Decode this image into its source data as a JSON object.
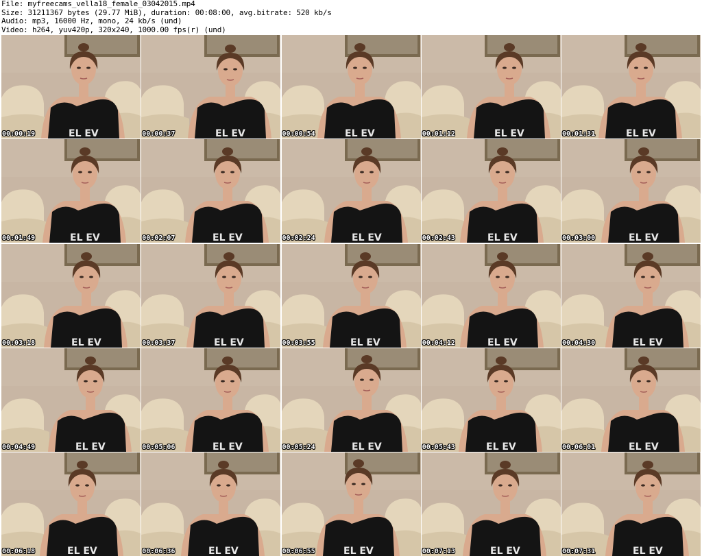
{
  "header": {
    "file_line": "File: myfreecams_vella18_female_03042015.mp4",
    "size_line": "Size: 31211367 bytes (29.77 MiB), duration: 00:08:00, avg.bitrate: 520 kb/s",
    "audio_line": "Audio: mp3, 16000 Hz, mono, 24 kb/s (und)",
    "video_line": "Video: h264, yuv420p, 320x240, 1000.00 fps(r) (und)"
  },
  "thumbnails": [
    {
      "timestamp": "00:00:19"
    },
    {
      "timestamp": "00:00:37"
    },
    {
      "timestamp": "00:00:54"
    },
    {
      "timestamp": "00:01:12"
    },
    {
      "timestamp": "00:01:31"
    },
    {
      "timestamp": "00:01:49"
    },
    {
      "timestamp": "00:02:07"
    },
    {
      "timestamp": "00:02:24"
    },
    {
      "timestamp": "00:02:43"
    },
    {
      "timestamp": "00:03:00"
    },
    {
      "timestamp": "00:03:18"
    },
    {
      "timestamp": "00:03:37"
    },
    {
      "timestamp": "00:03:55"
    },
    {
      "timestamp": "00:04:12"
    },
    {
      "timestamp": "00:04:30"
    },
    {
      "timestamp": "00:04:49"
    },
    {
      "timestamp": "00:05:06"
    },
    {
      "timestamp": "00:05:24"
    },
    {
      "timestamp": "00:05:43"
    },
    {
      "timestamp": "00:06:01"
    },
    {
      "timestamp": "00:06:18"
    },
    {
      "timestamp": "00:06:36"
    },
    {
      "timestamp": "00:06:55"
    },
    {
      "timestamp": "00:07:13"
    },
    {
      "timestamp": "00:07:31"
    }
  ],
  "colors": {
    "wall": "#c8b6a4",
    "sofa": "#e4d6bb",
    "skin": "#d9aa8e",
    "hair": "#5a3a26",
    "shirt": "#141414",
    "frame": "#7a6a50"
  }
}
